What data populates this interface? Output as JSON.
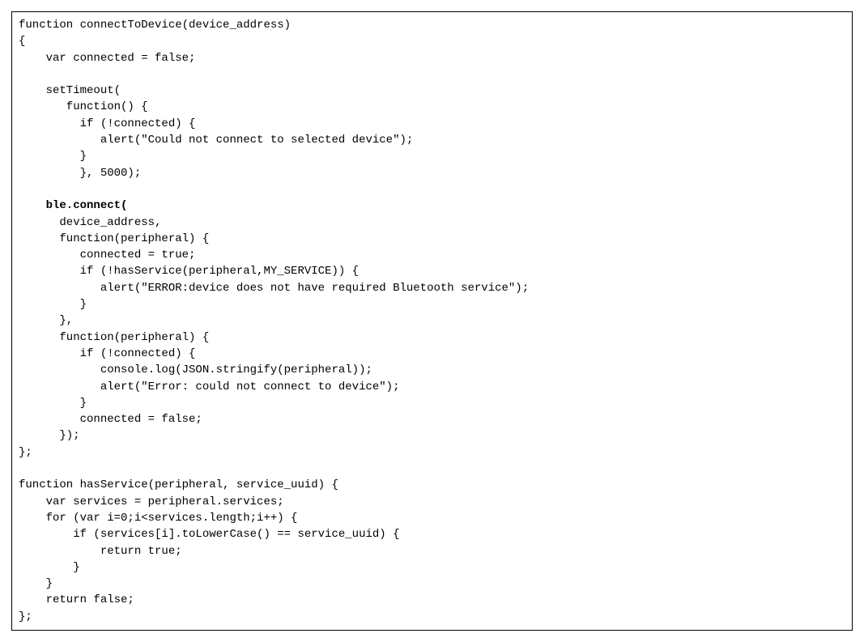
{
  "code": {
    "lines": [
      {
        "text": "function connectToDevice(device_address)",
        "bold": false
      },
      {
        "text": "{",
        "bold": false
      },
      {
        "text": "    var connected = false;",
        "bold": false
      },
      {
        "text": "",
        "bold": false
      },
      {
        "text": "    setTimeout(",
        "bold": false
      },
      {
        "text": "       function() {",
        "bold": false
      },
      {
        "text": "         if (!connected) {",
        "bold": false
      },
      {
        "text": "            alert(\"Could not connect to selected device\");",
        "bold": false
      },
      {
        "text": "         }",
        "bold": false
      },
      {
        "text": "         }, 5000);",
        "bold": false
      },
      {
        "text": "",
        "bold": false
      },
      {
        "text": "    ble.connect(",
        "bold": true
      },
      {
        "text": "      device_address,",
        "bold": false
      },
      {
        "text": "      function(peripheral) {",
        "bold": false
      },
      {
        "text": "         connected = true;",
        "bold": false
      },
      {
        "text": "         if (!hasService(peripheral,MY_SERVICE)) {",
        "bold": false
      },
      {
        "text": "            alert(\"ERROR:device does not have required Bluetooth service\");",
        "bold": false
      },
      {
        "text": "         }",
        "bold": false
      },
      {
        "text": "      },",
        "bold": false
      },
      {
        "text": "      function(peripheral) {",
        "bold": false
      },
      {
        "text": "         if (!connected) {",
        "bold": false
      },
      {
        "text": "            console.log(JSON.stringify(peripheral));",
        "bold": false
      },
      {
        "text": "            alert(\"Error: could not connect to device\");",
        "bold": false
      },
      {
        "text": "         }",
        "bold": false
      },
      {
        "text": "         connected = false;",
        "bold": false
      },
      {
        "text": "      });",
        "bold": false
      },
      {
        "text": "};",
        "bold": false
      },
      {
        "text": "",
        "bold": false
      },
      {
        "text": "function hasService(peripheral, service_uuid) {",
        "bold": false
      },
      {
        "text": "    var services = peripheral.services;",
        "bold": false
      },
      {
        "text": "    for (var i=0;i<services.length;i++) {",
        "bold": false
      },
      {
        "text": "        if (services[i].toLowerCase() == service_uuid) {",
        "bold": false
      },
      {
        "text": "            return true;",
        "bold": false
      },
      {
        "text": "        }",
        "bold": false
      },
      {
        "text": "    }",
        "bold": false
      },
      {
        "text": "    return false;",
        "bold": false
      },
      {
        "text": "};",
        "bold": false
      }
    ]
  }
}
